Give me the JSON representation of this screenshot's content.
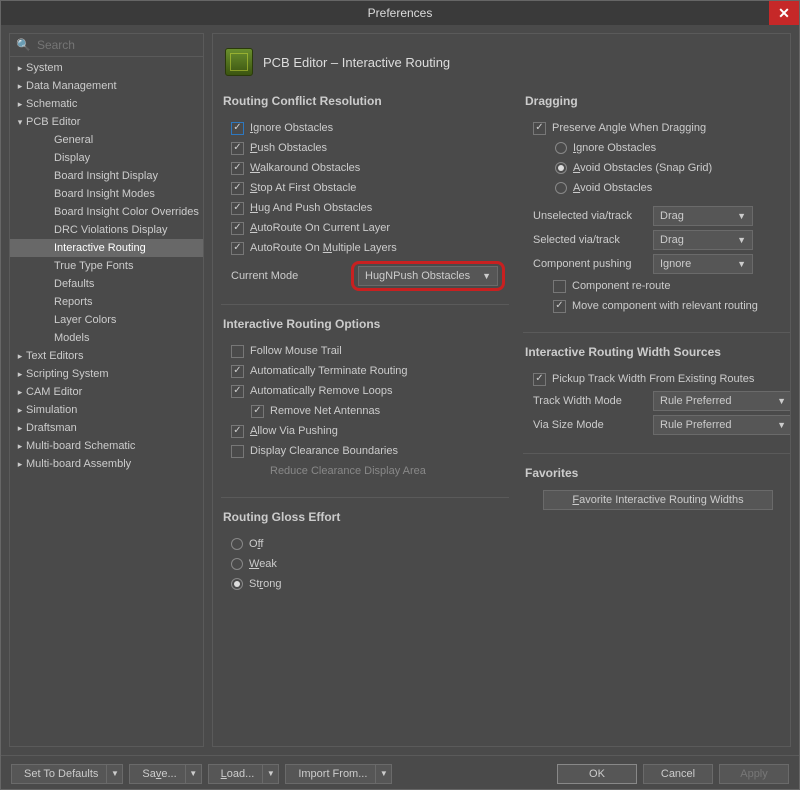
{
  "window": {
    "title": "Preferences"
  },
  "search": {
    "placeholder": "Search"
  },
  "tree": [
    {
      "label": "System",
      "exp": false,
      "children": []
    },
    {
      "label": "Data Management",
      "exp": false,
      "children": []
    },
    {
      "label": "Schematic",
      "exp": false,
      "children": []
    },
    {
      "label": "PCB Editor",
      "exp": true,
      "children": [
        "General",
        "Display",
        "Board Insight Display",
        "Board Insight Modes",
        "Board Insight Color Overrides",
        "DRC Violations Display",
        "Interactive Routing",
        "True Type Fonts",
        "Defaults",
        "Reports",
        "Layer Colors",
        "Models"
      ],
      "selected": "Interactive Routing"
    },
    {
      "label": "Text Editors",
      "exp": false,
      "children": []
    },
    {
      "label": "Scripting System",
      "exp": false,
      "children": []
    },
    {
      "label": "CAM Editor",
      "exp": false,
      "children": []
    },
    {
      "label": "Simulation",
      "exp": false,
      "children": []
    },
    {
      "label": "Draftsman",
      "exp": false,
      "children": []
    },
    {
      "label": "Multi-board Schematic",
      "exp": false,
      "children": []
    },
    {
      "label": "Multi-board Assembly",
      "exp": false,
      "children": []
    }
  ],
  "page": {
    "title": "PCB Editor – Interactive Routing",
    "conflict": {
      "heading": "Routing Conflict Resolution",
      "items": [
        {
          "label": "Ignore Obstacles",
          "checked": true,
          "u": "I",
          "hl": true
        },
        {
          "label": "Push Obstacles",
          "checked": true,
          "u": "P"
        },
        {
          "label": "Walkaround Obstacles",
          "checked": true,
          "u": "W"
        },
        {
          "label": "Stop At First Obstacle",
          "checked": true,
          "u": "S"
        },
        {
          "label": "Hug And Push Obstacles",
          "checked": true,
          "u": "H"
        },
        {
          "label": "AutoRoute On Current Layer",
          "checked": true,
          "u": "A"
        },
        {
          "label": "AutoRoute On Multiple Layers",
          "checked": true,
          "u": "M"
        }
      ],
      "current_mode_label": "Current Mode",
      "current_mode_value": "HugNPush Obstacles"
    },
    "options": {
      "heading": "Interactive Routing Options",
      "follow": "Follow Mouse Trail",
      "follow_checked": false,
      "auto_term": "Automatically Terminate Routing",
      "auto_term_checked": true,
      "auto_rm_loops": "Automatically Remove Loops",
      "auto_rm_loops_checked": true,
      "remove_net": "Remove Net Antennas",
      "remove_net_checked": true,
      "allow_via": "Allow Via Pushing",
      "allow_via_u": "A",
      "allow_via_checked": true,
      "disp_clear": "Display Clearance Boundaries",
      "disp_clear_checked": false,
      "reduce": "Reduce Clearance Display Area"
    },
    "gloss": {
      "heading": "Routing Gloss Effort",
      "off": "Off",
      "off_u": "f",
      "weak": "Weak",
      "weak_u": "W",
      "strong": "Strong",
      "strong_u": "r",
      "value": "strong"
    },
    "dragging": {
      "heading": "Dragging",
      "preserve": "Preserve Angle When Dragging",
      "preserve_checked": true,
      "ignore": "Ignore Obstacles",
      "ignore_u": "I",
      "avoid_snap": "Avoid Obstacles (Snap Grid)",
      "avoid_snap_u": "A",
      "avoid": "Avoid Obstacles",
      "avoid_u": "A",
      "drag_radio": "avoid_snap",
      "unselected_label": "Unselected via/track",
      "unselected_value": "Drag",
      "selected_label": "Selected via/track",
      "selected_value": "Drag",
      "component_label": "Component pushing",
      "component_value": "Ignore",
      "comp_reroute": "Component re-route",
      "comp_reroute_checked": false,
      "move_comp": "Move component with relevant routing",
      "move_comp_checked": true
    },
    "widths": {
      "heading": "Interactive Routing Width Sources",
      "pickup": "Pickup Track Width From Existing Routes",
      "pickup_checked": true,
      "track_label": "Track Width Mode",
      "track_value": "Rule Preferred",
      "via_label": "Via Size Mode",
      "via_value": "Rule Preferred"
    },
    "favorites": {
      "heading": "Favorites",
      "button": "Favorite Interactive Routing Widths",
      "u": "F"
    }
  },
  "footer": {
    "set_defaults": "Set To Defaults",
    "save": "Save...",
    "save_u": "v",
    "load": "Load...",
    "load_u": "L",
    "import": "Import From...",
    "ok": "OK",
    "cancel": "Cancel",
    "apply": "Apply"
  }
}
